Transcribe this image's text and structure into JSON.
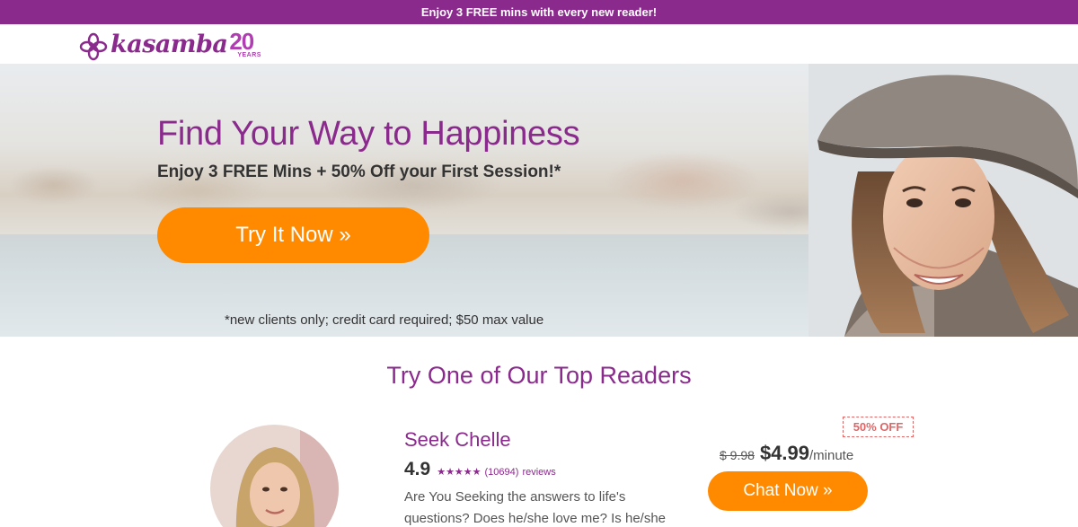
{
  "promo_bar": {
    "text": "Enjoy 3 FREE mins with every new reader!"
  },
  "header": {
    "logo_text": "kasamba",
    "logo_anniversary_number": "20",
    "logo_anniversary_label": "YEARS"
  },
  "hero": {
    "title": "Find Your Way to Happiness",
    "subtitle": "Enjoy 3 FREE Mins + 50% Off your First Session!*",
    "cta_label": "Try It Now »",
    "disclaimer": "*new clients only; credit card required; $50 max value"
  },
  "top_readers": {
    "title": "Try One of Our Top Readers",
    "readers": [
      {
        "name": "Seek Chelle",
        "rating": "4.9",
        "stars": "★★★★★",
        "review_count": "(10694)",
        "review_label": "reviews",
        "description": "Are You Seeking the answers to life's questions? Does he/she love me? Is he/she",
        "discount_badge": "50% OFF",
        "old_price": "$ 9.98",
        "new_price": "$4.99",
        "price_unit": "/minute",
        "cta_label": "Chat Now »"
      }
    ]
  },
  "colors": {
    "brand_purple": "#8a2a8c",
    "cta_orange": "#ff8a00",
    "discount_red": "#e06666"
  },
  "icons": {
    "logo_mark": "kasamba-flower-icon"
  }
}
